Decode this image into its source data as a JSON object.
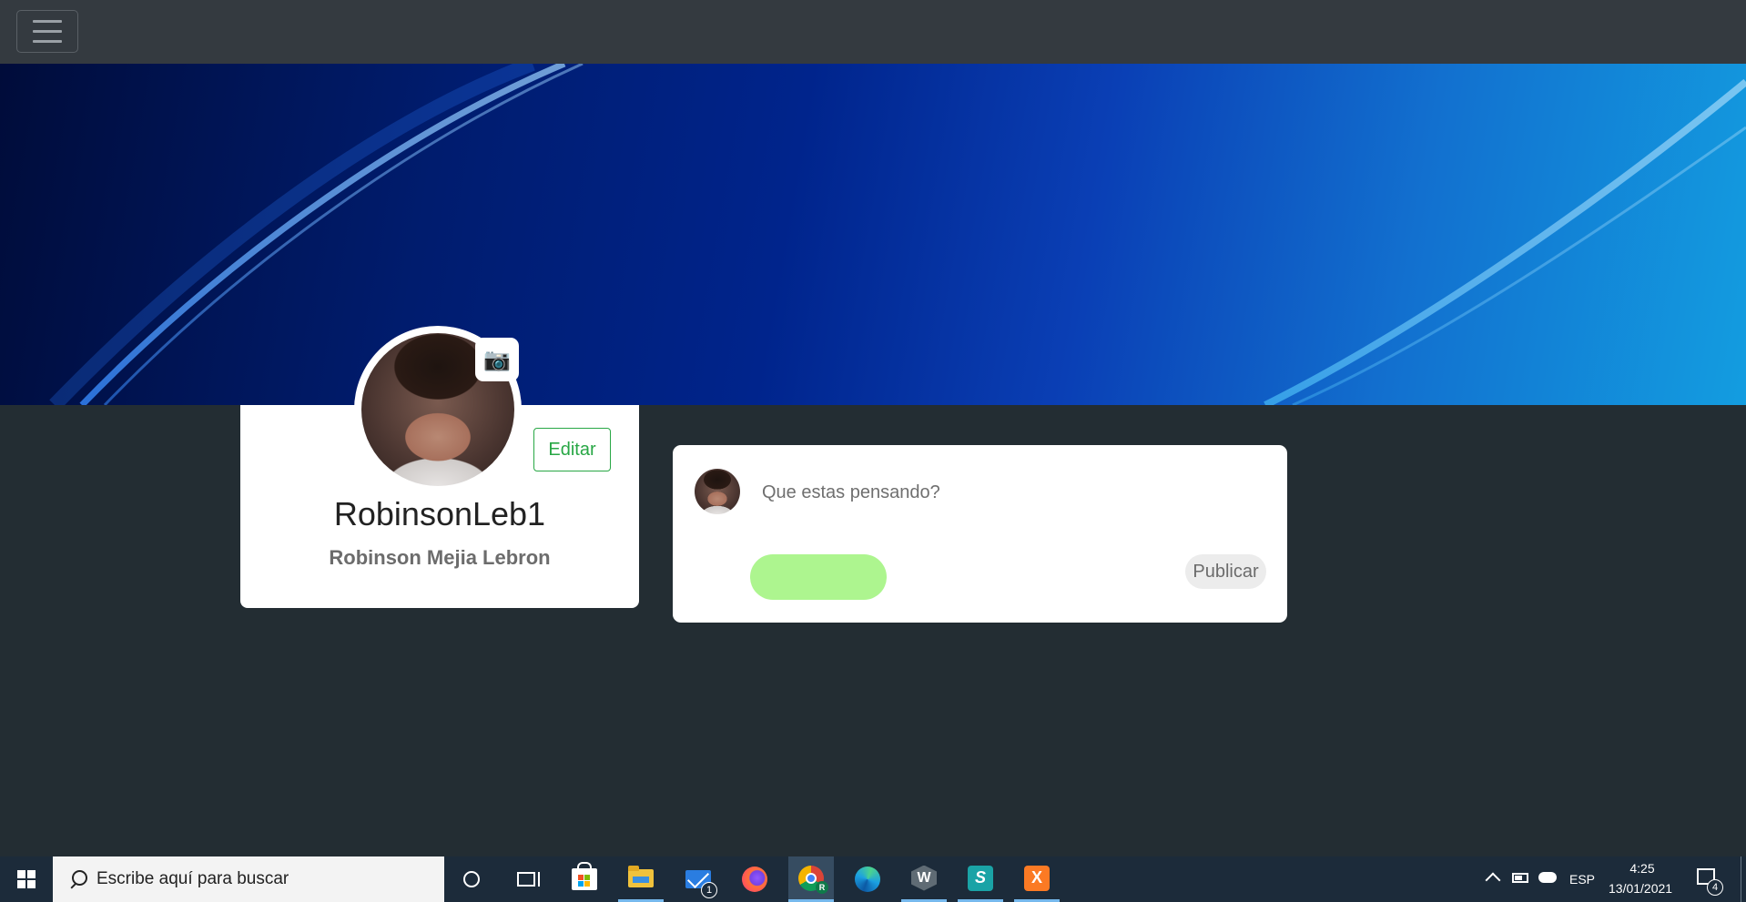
{
  "navbar": {
    "menu_icon": "hamburger-menu-icon"
  },
  "profile": {
    "camera_icon": "📷",
    "edit_label": "Editar",
    "username": "RobinsonLeb1",
    "full_name": "Robinson Mejia Lebron"
  },
  "post": {
    "placeholder": "Que estas pensando?",
    "publish_label": "Publicar"
  },
  "taskbar": {
    "search_placeholder": "Escribe aquí para buscar",
    "mail_badge": "1",
    "chrome_profile_letter": "R",
    "w_app_letter": "W",
    "s_app_letter": "S",
    "x_app_letter": "X",
    "language": "ESP",
    "time": "4:25",
    "date": "13/01/2021",
    "notifications_count": "4"
  },
  "colors": {
    "navbar": "#343a40",
    "page_background": "#232d33",
    "edit_button": "#28a745",
    "green_pill": "#adf58f",
    "taskbar": "#1c2b3a"
  }
}
